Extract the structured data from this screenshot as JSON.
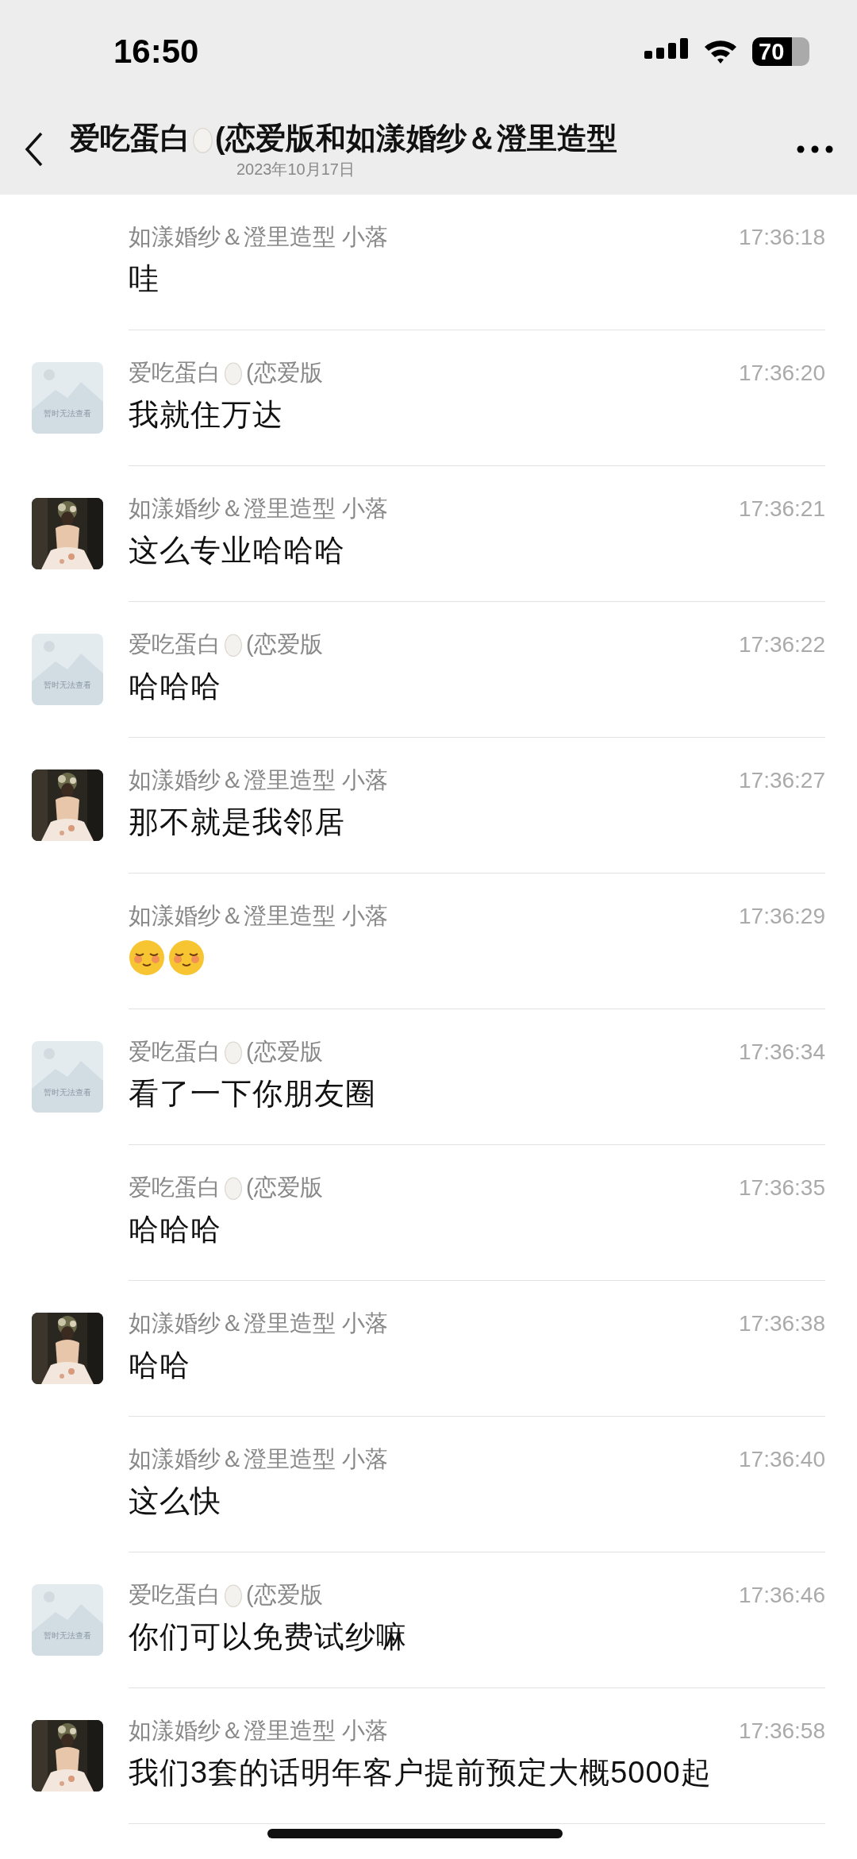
{
  "status_bar": {
    "time": "16:50",
    "battery": "70"
  },
  "header": {
    "title_before": "爱吃蛋白",
    "title_egg": true,
    "title_after": "(恋爱版和如漾婚纱＆澄里造型",
    "date": "2023年10月17日"
  },
  "messages": [
    {
      "name": "如漾婚纱＆澄里造型 小落",
      "egg": false,
      "time": "17:36:18",
      "text": "哇",
      "avatar": {
        "kind": "none"
      }
    },
    {
      "name": "爱吃蛋白",
      "egg": true,
      "name_after": "(恋爱版",
      "time": "17:36:20",
      "text": "我就住万达",
      "avatar": {
        "kind": "placeholder",
        "label": "暂时无法查看"
      }
    },
    {
      "name": "如漾婚纱＆澄里造型 小落",
      "egg": false,
      "time": "17:36:21",
      "text": "这么专业哈哈哈"
    },
    {
      "name": "爱吃蛋白",
      "egg": true,
      "name_after": "(恋爱版",
      "time": "17:36:22",
      "text": "哈哈哈",
      "avatar": {
        "kind": "placeholder",
        "label": "暂时无法查看"
      }
    },
    {
      "name": "如漾婚纱＆澄里造型 小落",
      "egg": false,
      "time": "17:36:27",
      "text": "那不就是我邻居"
    },
    {
      "name": "如漾婚纱＆澄里造型 小落",
      "egg": false,
      "time": "17:36:29",
      "emoji": [
        {
          "kind": "blush"
        },
        {
          "kind": "blush"
        }
      ],
      "avatar": {
        "kind": "none"
      }
    },
    {
      "name": "爱吃蛋白",
      "egg": true,
      "name_after": "(恋爱版",
      "time": "17:36:34",
      "text": "看了一下你朋友圈",
      "avatar": {
        "kind": "placeholder",
        "label": "暂时无法查看"
      }
    },
    {
      "name": "爱吃蛋白",
      "egg": true,
      "name_after": "(恋爱版",
      "time": "17:36:35",
      "text": "哈哈哈",
      "avatar": {
        "kind": "none"
      }
    },
    {
      "name": "如漾婚纱＆澄里造型 小落",
      "egg": false,
      "time": "17:36:38",
      "text": "哈哈"
    },
    {
      "name": "如漾婚纱＆澄里造型 小落",
      "egg": false,
      "time": "17:36:40",
      "text": "这么快",
      "avatar": {
        "kind": "none"
      }
    },
    {
      "name": "爱吃蛋白",
      "egg": true,
      "name_after": "(恋爱版",
      "time": "17:36:46",
      "text": "你们可以免费试纱嘛",
      "avatar": {
        "kind": "placeholder",
        "label": "暂时无法查看"
      }
    },
    {
      "name": "如漾婚纱＆澄里造型 小落",
      "egg": false,
      "time": "17:36:58",
      "text": "我们3套的话明年客户提前预定大概5000起"
    }
  ]
}
